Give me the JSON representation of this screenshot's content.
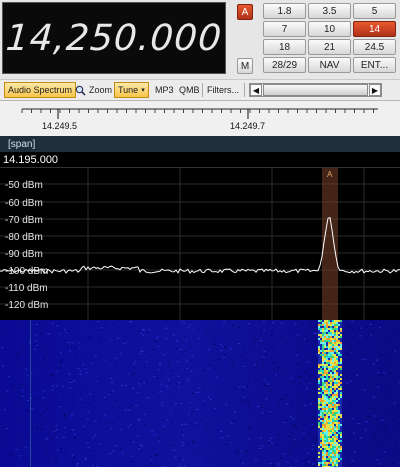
{
  "vfo": {
    "frequency": "14,250.000"
  },
  "side_buttons": {
    "a_label": "A",
    "m_label": "M"
  },
  "band_buttons": [
    {
      "label": "1.8",
      "active": false
    },
    {
      "label": "3.5",
      "active": false
    },
    {
      "label": "5",
      "active": false
    },
    {
      "label": "7",
      "active": false
    },
    {
      "label": "10",
      "active": false
    },
    {
      "label": "14",
      "active": true
    },
    {
      "label": "18",
      "active": false
    },
    {
      "label": "21",
      "active": false
    },
    {
      "label": "24.5",
      "active": false
    },
    {
      "label": "28/29",
      "active": false
    },
    {
      "label": "NAV",
      "active": false
    },
    {
      "label": "ENT...",
      "active": false
    }
  ],
  "toolbar": {
    "audio_spectrum": "Audio Spectrum",
    "zoom": "Zoom",
    "tune": "Tune",
    "mp3": "MP3",
    "qmb": "QMB",
    "filters": "Filters..."
  },
  "ruler": {
    "labels": [
      "14.249.5",
      "14.249.7"
    ]
  },
  "span": {
    "label": "[span]"
  },
  "spectrum": {
    "center_frequency": "14.195.000",
    "marker_label": "A",
    "y_labels": [
      "-50 dBm",
      "-60 dBm",
      "-70 dBm",
      "-80 dBm",
      "-90 dBm",
      "-100 dBm",
      "-110 dBm",
      "-120 dBm"
    ]
  },
  "colors": {
    "active_button": "#c8401e",
    "tune_highlight": "#f7c54a",
    "trace": "#ffffff",
    "waterfall_bg": "#0b0b8c",
    "marker_band": "#8a4a2c"
  }
}
